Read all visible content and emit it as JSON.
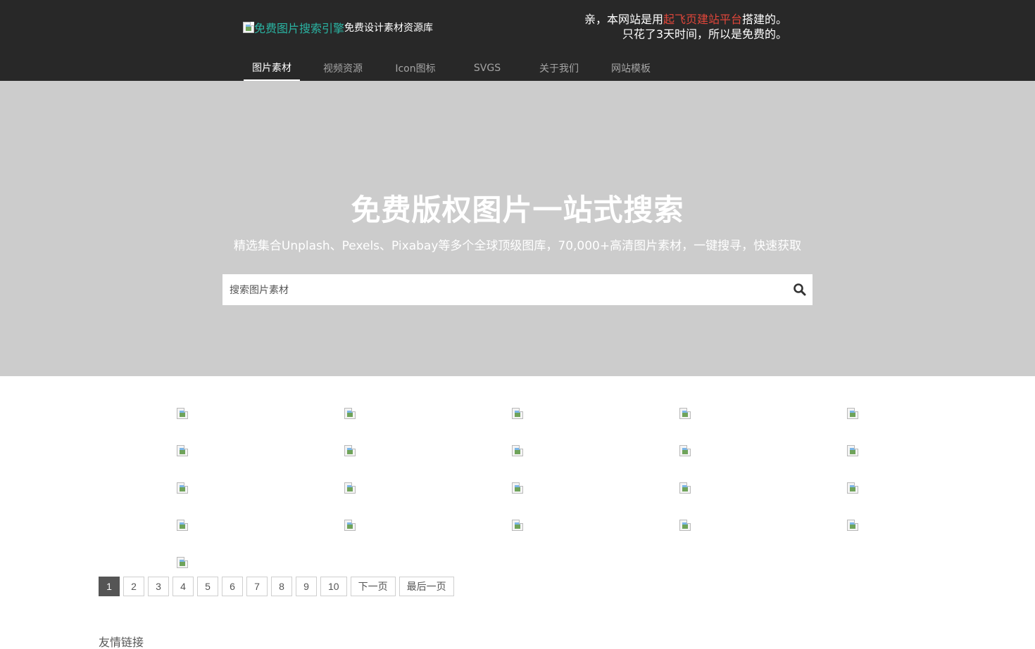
{
  "header": {
    "logo_alt": "免费图片搜索引擎",
    "logo_sub": "免费设计素材资源库",
    "notice": {
      "line1_prefix": "亲，本网站是用",
      "line1_highlight": "起飞页建站平台",
      "line1_suffix": "搭建的。",
      "line2": "只花了3天时间，所以是免费的。"
    },
    "nav": [
      {
        "label": "图片素材",
        "active": true
      },
      {
        "label": "视频资源",
        "active": false
      },
      {
        "label": "Icon图标",
        "active": false
      },
      {
        "label": "SVGS",
        "active": false
      },
      {
        "label": "关于我们",
        "active": false
      },
      {
        "label": "网站模板",
        "active": false
      }
    ]
  },
  "hero": {
    "title": "免费版权图片一站式搜索",
    "subtitle": "精选集合Unplash、Pexels、Pixabay等多个全球顶级图库，70,000+高清图片素材，一键搜寻，快速获取",
    "search_placeholder": "搜索图片素材",
    "search_icon": "search-icon"
  },
  "grid": {
    "image_count": 21,
    "image_icon": "broken-image-icon"
  },
  "pagination": {
    "pages": [
      "1",
      "2",
      "3",
      "4",
      "5",
      "6",
      "7",
      "8",
      "9",
      "10"
    ],
    "current": "1",
    "next_label": "下一页",
    "last_label": "最后一页"
  },
  "footer": {
    "friend_links_label": "友情链接"
  },
  "colors": {
    "header_bg": "#282828",
    "hero_bg": "#cccccc",
    "highlight": "#e0463a",
    "logo_alt": "#2ab3a2",
    "pager_current": "#555555"
  }
}
